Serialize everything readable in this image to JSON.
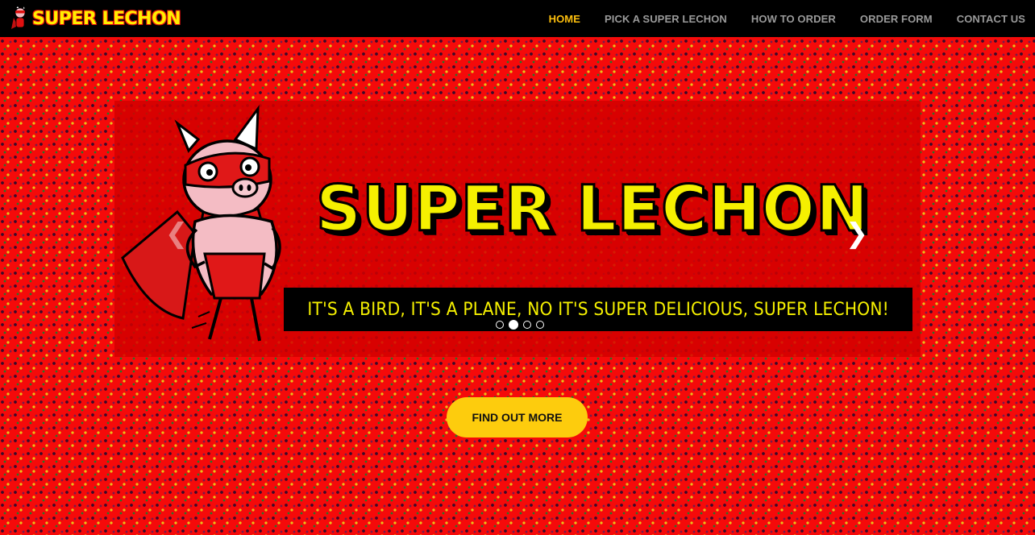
{
  "brand": {
    "name": "SUPER LECHON",
    "icon": "pig-hero-logo-icon"
  },
  "nav": {
    "items": [
      {
        "label": "HOME",
        "active": true
      },
      {
        "label": "PICK A SUPER LECHON",
        "active": false
      },
      {
        "label": "HOW TO ORDER",
        "active": false
      },
      {
        "label": "ORDER FORM",
        "active": false
      },
      {
        "label": "CONTACT US",
        "active": false
      }
    ]
  },
  "carousel": {
    "slide_title": "SUPER LECHON",
    "tagline": "IT'S A BIRD, IT'S A PLANE, NO IT'S SUPER DELICIOUS, SUPER LECHON!",
    "prev_icon": "chevron-left-icon",
    "next_icon": "chevron-right-icon",
    "indicator_count": 4,
    "active_indicator": 2
  },
  "cta": {
    "label": "FIND OUT MORE"
  },
  "colors": {
    "background": "#f50a0a",
    "navbar": "#000000",
    "nav_active": "#fdbf0d",
    "nav_inactive": "#9a9a9a",
    "cta": "#fdcc0d",
    "title_yellow": "#f5f000"
  }
}
